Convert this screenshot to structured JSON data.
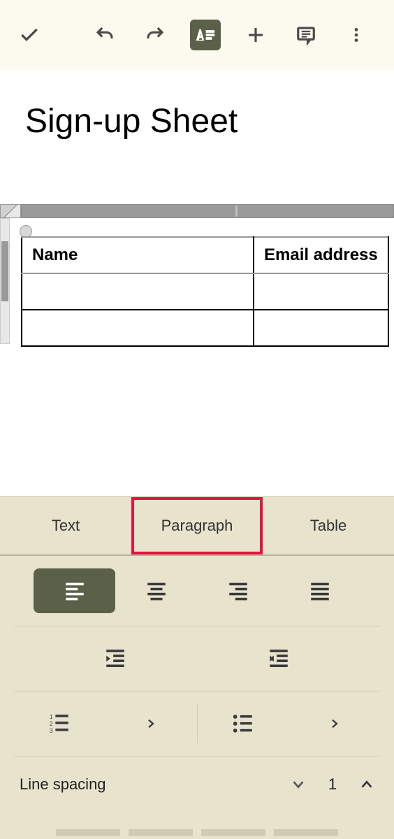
{
  "toolbar": {
    "icons": [
      "check",
      "undo",
      "redo",
      "text-format",
      "plus",
      "comment",
      "more-vert"
    ]
  },
  "document": {
    "title": "Sign-up Sheet",
    "table": {
      "headers": [
        "Name",
        "Email address"
      ],
      "rows": [
        [
          "",
          ""
        ],
        [
          "",
          ""
        ]
      ]
    }
  },
  "panel": {
    "tabs": [
      "Text",
      "Paragraph",
      "Table"
    ],
    "active_tab_index": 1,
    "alignment_selected": "left",
    "line_spacing": {
      "label": "Line spacing",
      "value": "1"
    }
  }
}
